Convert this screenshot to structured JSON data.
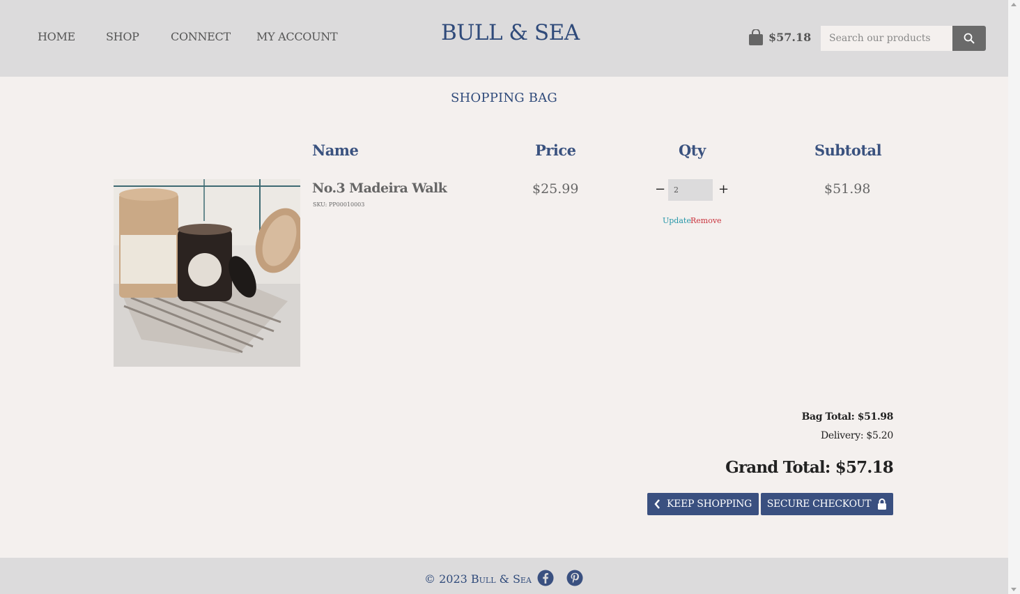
{
  "header": {
    "nav": [
      {
        "label": "HOME"
      },
      {
        "label": "SHOP"
      },
      {
        "label": "CONNECT"
      },
      {
        "label": "MY ACCOUNT"
      }
    ],
    "logo": "BULL & SEA",
    "bag_amount": "$57.18",
    "search_placeholder": "Search our products"
  },
  "page_title": "SHOPPING BAG",
  "table": {
    "headers": [
      "Name",
      "Price",
      "Qty",
      "Subtotal"
    ]
  },
  "items": [
    {
      "name": "No.3 Madeira Walk",
      "sku": "SKU: PP00010003",
      "price": "$25.99",
      "qty": "2",
      "subtotal": "$51.98",
      "update_label": "Update",
      "remove_label": "Remove",
      "minus": "−",
      "plus": "+"
    }
  ],
  "totals": {
    "bag_total": "Bag Total: $51.98",
    "delivery": "Delivery: $5.20",
    "grand_total": "Grand Total: $57.18"
  },
  "buttons": {
    "keep_shopping": "KEEP SHOPPING",
    "secure_checkout": "SECURE CHECKOUT"
  },
  "footer": {
    "copyright": "© 2023 Bull & Sea",
    "social": [
      "facebook-icon",
      "pinterest-icon"
    ]
  },
  "colors": {
    "brand_navy": "#3a5080",
    "header_bg": "#dcdbdc",
    "page_bg": "#f4f0ee",
    "link_update": "#2596a8",
    "link_remove": "#c9323c"
  }
}
